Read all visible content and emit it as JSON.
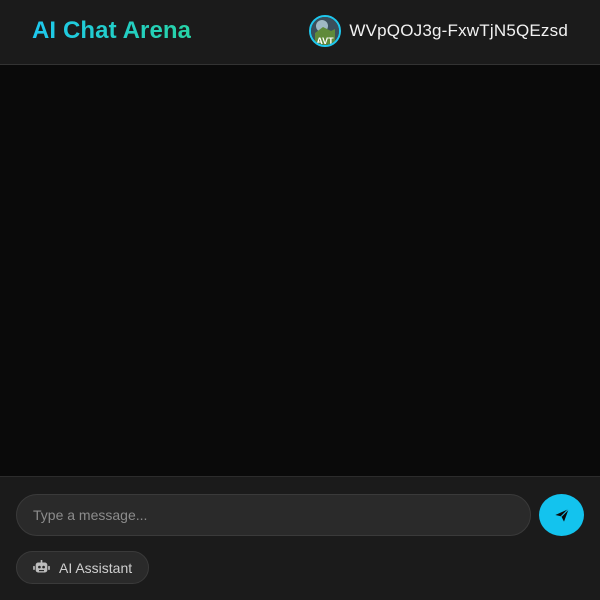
{
  "header": {
    "title": "AI Chat Arena",
    "username": "WVpQOJ3g-FxwTjN5QEzsd",
    "avatar_icon": "user-avatar",
    "avatar_alt_text": "AVT"
  },
  "composer": {
    "placeholder": "Type a message...",
    "value": "",
    "send_icon": "paper-plane-icon"
  },
  "assistant": {
    "label": "AI Assistant",
    "icon": "robot-icon"
  },
  "colors": {
    "accent": "#13c3ee",
    "title_gradient_start": "#1ec8ee",
    "title_gradient_end": "#27d3a6",
    "header_bg": "#1b1b1b",
    "chat_bg": "#0a0a0a"
  }
}
